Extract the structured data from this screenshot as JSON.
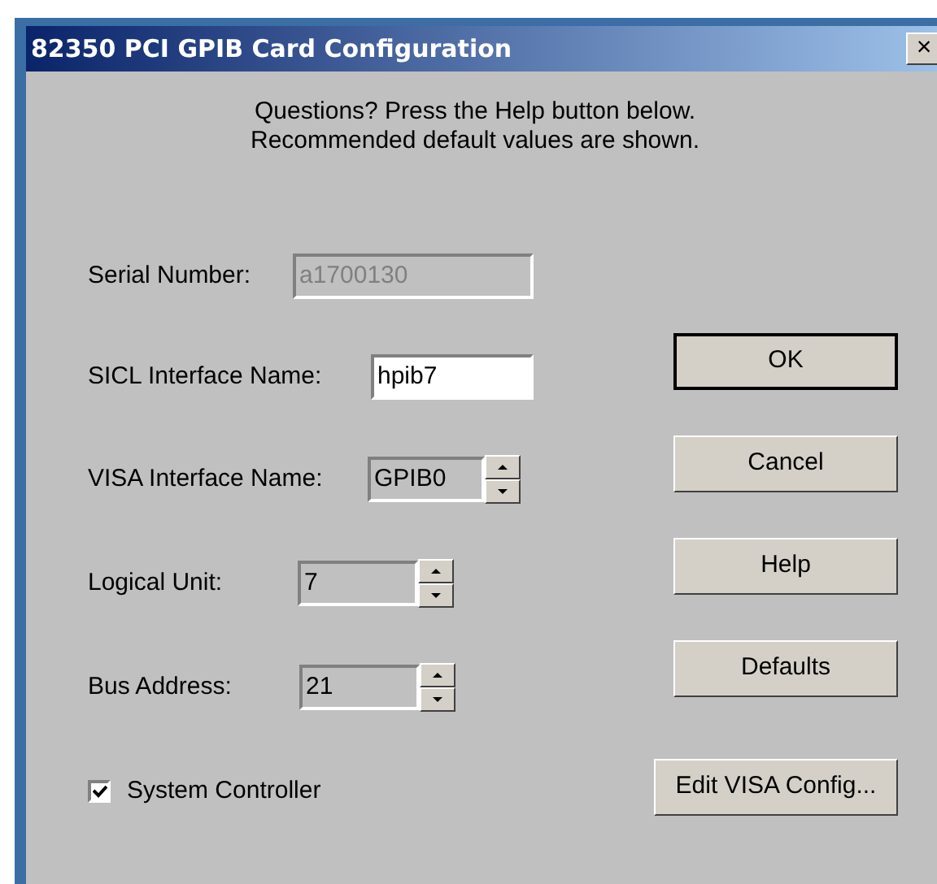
{
  "window": {
    "title": "82350 PCI GPIB Card Configuration",
    "close": "×"
  },
  "intro": [
    "Questions?  Press the Help button below.",
    "Recommended default values are shown."
  ],
  "fields": [
    {
      "label": "Serial Number:",
      "value": "a1700130",
      "kind": "text",
      "disabled": true
    },
    {
      "label": "SICL Interface Name:",
      "value": "hpib7",
      "kind": "text",
      "disabled": false
    },
    {
      "label": "VISA Interface Name:",
      "value": "GPIB0",
      "kind": "spinner",
      "disabled": false
    },
    {
      "label": "Logical Unit:",
      "value": "7",
      "kind": "spinner",
      "disabled": false
    },
    {
      "label": "Bus Address:",
      "value": "21",
      "kind": "spinner",
      "disabled": false
    }
  ],
  "checkbox": {
    "label": "System Controller",
    "checked": true
  },
  "buttons": [
    {
      "label": "OK",
      "default": true
    },
    {
      "label": "Cancel",
      "default": false
    },
    {
      "label": "Help",
      "default": false
    },
    {
      "label": "Defaults",
      "default": false
    }
  ],
  "extra_button": {
    "label": "Edit VISA Config..."
  }
}
